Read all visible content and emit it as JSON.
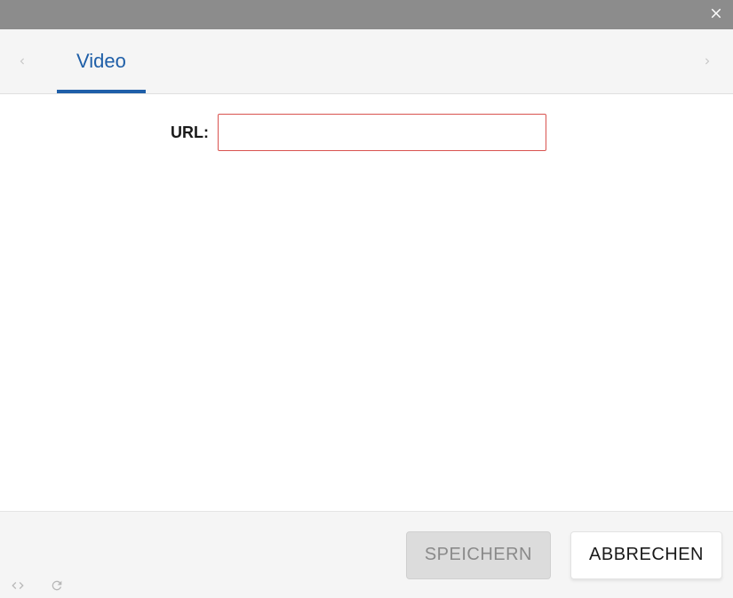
{
  "header": {},
  "tabs": {
    "active": "Video"
  },
  "form": {
    "url_label": "URL:",
    "url_value": ""
  },
  "footer": {
    "save_label": "SPEICHERN",
    "cancel_label": "ABBRECHEN"
  }
}
